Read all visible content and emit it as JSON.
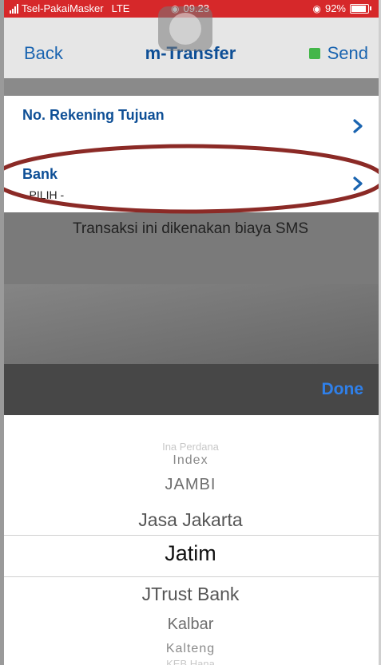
{
  "status_bar": {
    "carrier": "Tsel-PakaiMasker",
    "network": "LTE",
    "time": "09.23",
    "battery_percent": "92%",
    "background_color": "#d6282a"
  },
  "nav": {
    "back_label": "Back",
    "title": "m-Transfer",
    "send_label": "Send",
    "send_indicator_color": "#43b649"
  },
  "form": {
    "rekening": {
      "label": "No. Rekening Tujuan"
    },
    "bank": {
      "label": "Bank",
      "value": "- PILIH -"
    }
  },
  "note": "Transaksi ini dikenakan biaya SMS",
  "toolbar": {
    "done_label": "Done"
  },
  "picker": {
    "options": [
      "Ina Perdana",
      "Index",
      "JAMBI",
      "Jasa Jakarta",
      "Jatim",
      "JTrust Bank",
      "Kalbar",
      "Kalteng",
      "KEB Hana"
    ],
    "selected": "Jatim"
  },
  "colors": {
    "accent_blue": "#1a64b0",
    "title_blue": "#0e4f96",
    "done_blue": "#2f80ea",
    "highlight_ellipse": "#8b2a26"
  }
}
